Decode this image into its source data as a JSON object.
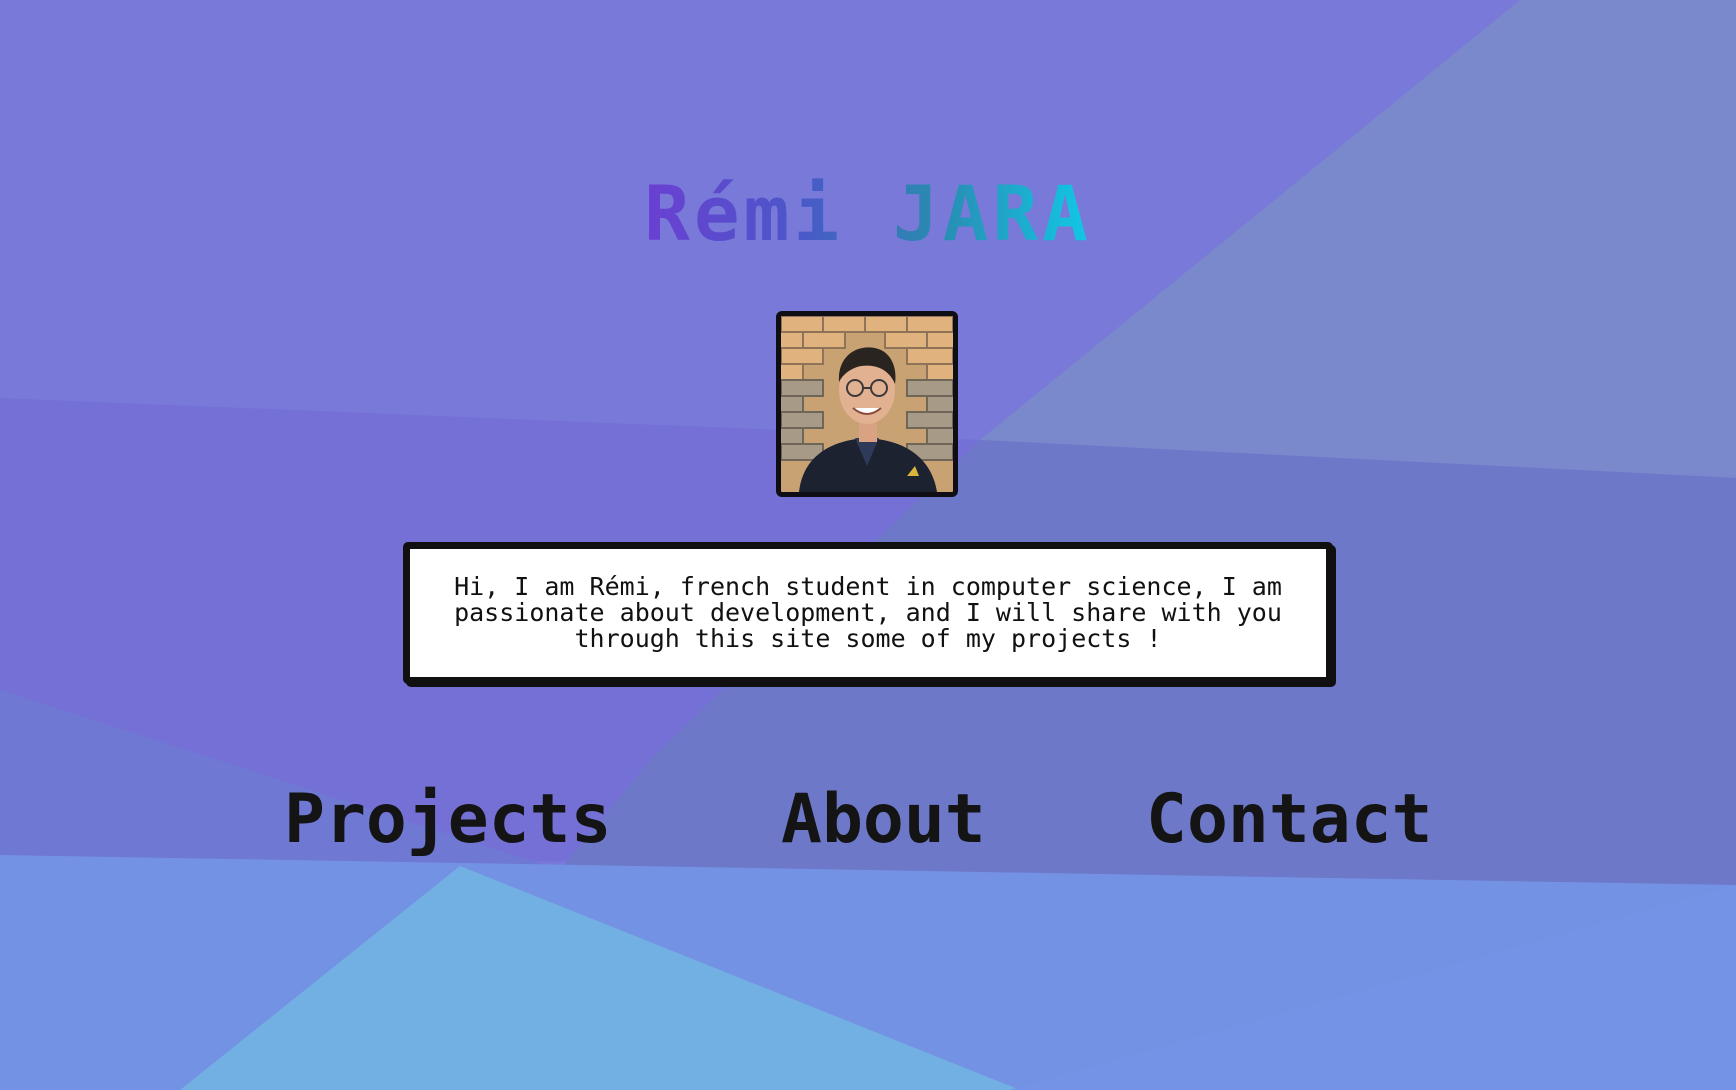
{
  "header": {
    "name": "Rémi JARA"
  },
  "profile": {
    "avatar_alt": "Portrait of Rémi in front of a brick wall"
  },
  "bio": {
    "text": "Hi, I am Rémi, french student in computer science, I am passionate about development, and I will share with you through this site some of my projects !"
  },
  "nav": {
    "projects_label": "Projects",
    "about_label": "About",
    "contact_label": "Contact"
  },
  "colors": {
    "background": "#7a7ad8",
    "title_gradient_start": "#6b3fd2",
    "title_gradient_end": "#12c8e6",
    "text": "#141414",
    "bio_background": "#ffffff"
  },
  "icons": {
    "avatar": "profile-photo"
  }
}
